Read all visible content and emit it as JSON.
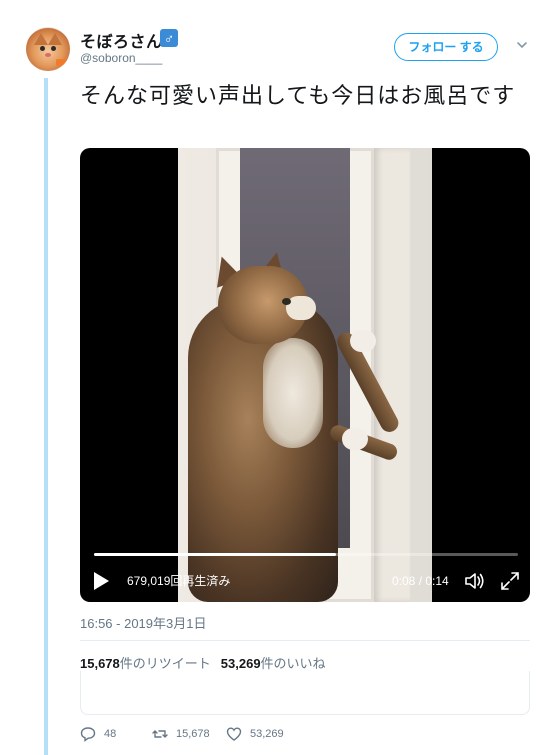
{
  "user": {
    "display_name": "そぼろさん",
    "gender_symbol": "♂",
    "handle": "@soboron____"
  },
  "follow_button": {
    "label": "フォロー する"
  },
  "tweet": {
    "text": "そんな可愛い声出しても今日はお風呂です",
    "timestamp": "16:56 - 2019年3月1日"
  },
  "video": {
    "views": "679,019回再生済み",
    "time": "0:08 / 0:14",
    "progress_fraction": 0.571
  },
  "stats": {
    "retweet_count": "15,678",
    "retweet_label": "件のリツイート",
    "like_count": "53,269",
    "like_label": "件のいいね"
  },
  "actions": {
    "reply_count": "48",
    "retweet_count": "15,678",
    "like_count": "53,269"
  },
  "colors": {
    "accent": "#1da1f2",
    "thread_line": "#b5dff7",
    "muted_text": "#657786"
  },
  "icons": [
    "caret-down-icon",
    "play-icon",
    "volume-icon",
    "fullscreen-icon",
    "reply-icon",
    "retweet-icon",
    "like-icon"
  ]
}
